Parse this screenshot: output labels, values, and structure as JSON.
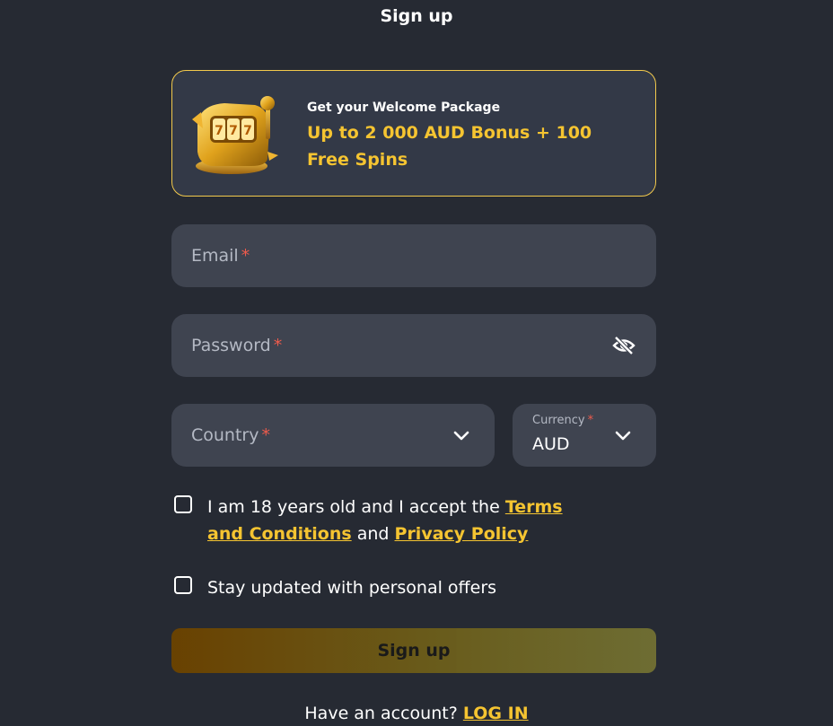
{
  "header": {
    "title": "Sign up"
  },
  "promo": {
    "art_icon": "golden-slot-machine-icon",
    "small_text": "Get your Welcome Package",
    "big_text": "Up to 2 000 AUD Bonus + 100 Free Spins",
    "border_color": "#f2c94c",
    "accent_color": "#f5c431"
  },
  "form": {
    "email": {
      "label": "Email",
      "required_mark": "*"
    },
    "password": {
      "label": "Password",
      "required_mark": "*",
      "toggle_icon": "eye-slash-icon"
    },
    "country": {
      "label": "Country",
      "required_mark": "*",
      "icon": "chevron-down-icon"
    },
    "currency": {
      "label": "Currency",
      "required_mark": "*",
      "value": "AUD",
      "icon": "chevron-down-icon"
    },
    "terms": {
      "text_before": "I am 18 years old and I accept the ",
      "terms_link": "Terms and Conditions",
      "text_middle": " and ",
      "privacy_link": "Privacy Policy",
      "checked": false
    },
    "offers": {
      "text": "Stay updated with personal offers",
      "checked": false
    },
    "submit_label": "Sign up"
  },
  "footer": {
    "question": "Have an account? ",
    "login_link": "LOG IN"
  },
  "colors": {
    "background": "#262a33",
    "field": "#3f4450",
    "required": "#ef5b4c",
    "link": "#f5c431"
  }
}
